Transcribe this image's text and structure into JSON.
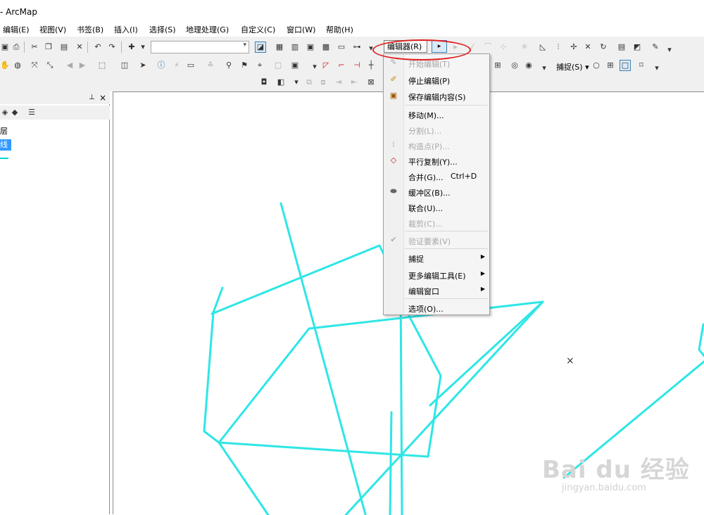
{
  "window": {
    "title": "- ArcMap"
  },
  "menubar": {
    "items": [
      "编辑(E)",
      "视图(V)",
      "书签(B)",
      "插入(I)",
      "选择(S)",
      "地理处理(G)",
      "自定义(C)",
      "窗口(W)",
      "帮助(H)"
    ]
  },
  "toolbar": {
    "editor_label": "编辑器(R)",
    "snapping_label": "捕捉(S)",
    "editor_highlight_color": "#e02020"
  },
  "toc": {
    "layers_label": "层",
    "selected_layer": "线",
    "layer_color": "#00d8d8"
  },
  "editor_menu": {
    "items": [
      {
        "label": "开始编辑(T)",
        "enabled": false,
        "icon": "start-edit-icon"
      },
      {
        "label": "停止编辑(P)",
        "enabled": true,
        "icon": "stop-edit-icon"
      },
      {
        "label": "保存编辑内容(S)",
        "enabled": true,
        "icon": "save-edits-icon"
      },
      {
        "label": "移动(M)...",
        "enabled": true
      },
      {
        "label": "分割(L)...",
        "enabled": false
      },
      {
        "label": "构造点(P)...",
        "enabled": false,
        "icon": "construct-points-icon"
      },
      {
        "label": "平行复制(Y)...",
        "enabled": true,
        "icon": "copy-parallel-icon"
      },
      {
        "label": "合并(G)...",
        "shortcut": "Ctrl+D",
        "enabled": true
      },
      {
        "label": "缓冲区(B)...",
        "enabled": true,
        "icon": "buffer-icon"
      },
      {
        "label": "联合(U)...",
        "enabled": true
      },
      {
        "label": "裁剪(C)...",
        "enabled": false
      },
      {
        "label": "验证要素(V)",
        "enabled": false,
        "icon": "validate-features-icon"
      },
      {
        "label": "捕捉",
        "enabled": true,
        "submenu": true
      },
      {
        "label": "更多编辑工具(E)",
        "enabled": true,
        "submenu": true
      },
      {
        "label": "编辑窗口",
        "enabled": true,
        "submenu": true
      },
      {
        "label": "选项(O)...",
        "enabled": true
      }
    ]
  },
  "map": {
    "line_color": "#2ee6e6"
  },
  "watermark": {
    "brand": "Bai du 经验",
    "domain": "jingyan.baidu.com"
  }
}
